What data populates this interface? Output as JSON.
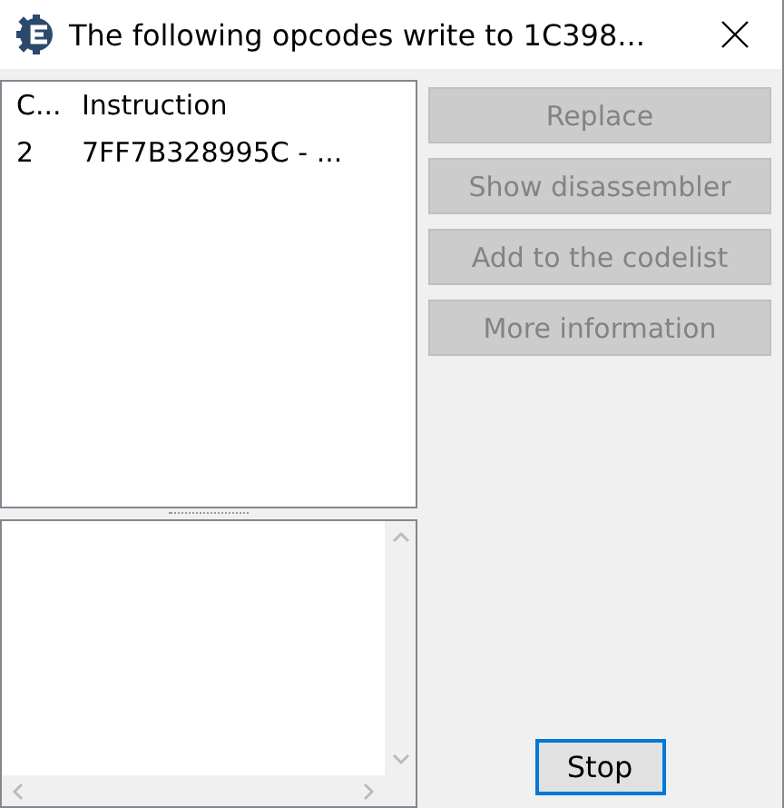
{
  "window": {
    "title": "The following opcodes write to 1C398..."
  },
  "table": {
    "columns": [
      "C...",
      "Instruction"
    ],
    "rows": [
      {
        "cells": [
          "2",
          "7FF7B328995C - ..."
        ]
      }
    ]
  },
  "buttons": [
    {
      "label": "Replace",
      "disabled": true
    },
    {
      "label": "Show disassembler",
      "disabled": true
    },
    {
      "label": "Add to the codelist",
      "disabled": true
    },
    {
      "label": "More information",
      "disabled": true
    }
  ],
  "stop_button": {
    "label": "Stop",
    "focused": true
  }
}
